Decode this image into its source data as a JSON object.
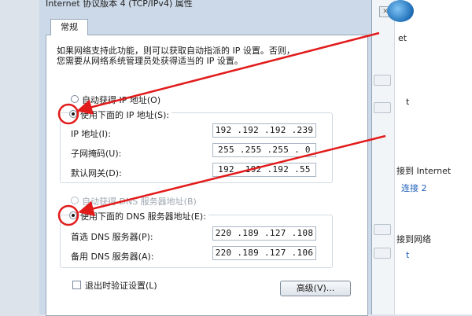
{
  "dialog": {
    "title": "Internet 协议版本 4 (TCP/IPv4) 属性",
    "tab_general": "常规",
    "intro_line1": "如果网络支持此功能，则可以获取自动指派的 IP 设置。否则，",
    "intro_line2": "您需要从网络系统管理员处获得适当的 IP 设置。",
    "ip_auto_label": "自动获得 IP 地址(O)",
    "ip_manual_label": "使用下面的 IP 地址(S):",
    "ip_address_label": "IP 地址(I):",
    "ip_address_value": "192 .192 .192 .239",
    "subnet_label": "子网掩码(U):",
    "subnet_value": "255 .255 .255 . 0",
    "gateway_label": "默认网关(D):",
    "gateway_value": "192 .192 .192 .55",
    "dns_auto_label": "自动获得 DNS 服务器地址(B)",
    "dns_manual_label": "使用下面的 DNS 服务器地址(E):",
    "dns_preferred_label": "首选 DNS 服务器(P):",
    "dns_preferred_value": "220 .189 .127 .108",
    "dns_alternate_label": "备用 DNS 服务器(A):",
    "dns_alternate_value": "220 .189 .127 .106",
    "validate_label": "退出时验证设置(L)",
    "advanced_button": "高级(V)..."
  },
  "background": {
    "text_net": "et",
    "text_t": "t",
    "text_connect": "接到 Internet",
    "text_local": "连接 2",
    "text_net2": "接到网络",
    "text_t2": "t"
  },
  "colors": {
    "annotation_red": "#e21b1b"
  }
}
